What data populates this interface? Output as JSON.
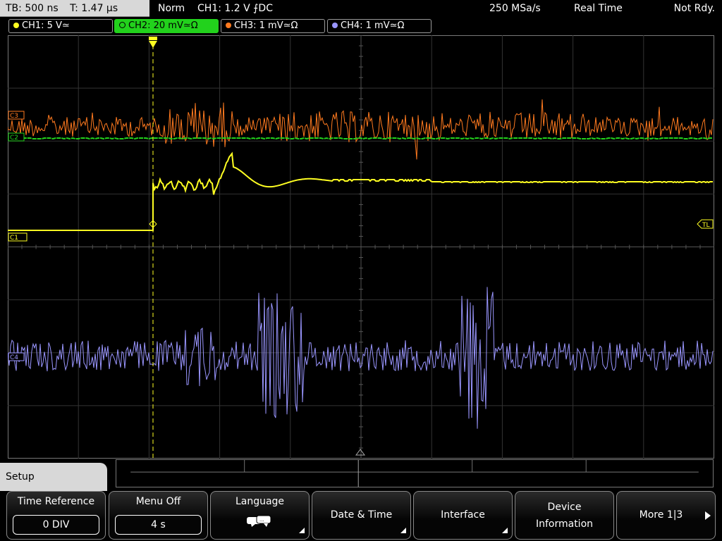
{
  "status": {
    "timebase": "TB: 500 ns",
    "trigger_time": "T: 1.47 µs",
    "mode": "Norm",
    "trigger_info": "CH1: 1.2 V ⨍DC",
    "sample_rate": "250 MSa/s",
    "acq_mode": "Real Time",
    "state": "Not Rdy."
  },
  "channels": [
    {
      "label": "CH1: 5 V≃",
      "color": "#ffff22"
    },
    {
      "label": "CH2: 20 mV≃Ω",
      "color": "#22d21c",
      "active": true
    },
    {
      "label": "CH3: 1 mV≃Ω",
      "color": "#ff7a1f"
    },
    {
      "label": "CH4: 1 mV≃Ω",
      "color": "#9a96ff"
    }
  ],
  "markers": {
    "c3": "C3",
    "c2": "C2",
    "c1": "C1",
    "c4": "C4",
    "tl": "TL"
  },
  "menu": {
    "title": "Setup",
    "softkeys": [
      {
        "label": "Time Reference",
        "value": "0 DIV"
      },
      {
        "label": "Menu Off",
        "value": "4 s"
      },
      {
        "label": "Language",
        "icon": "speech-bubbles-icon"
      },
      {
        "label": "Date & Time"
      },
      {
        "label": "Interface"
      },
      {
        "label1": "Device",
        "label2": "Information"
      },
      {
        "label": "More 1|3"
      }
    ]
  },
  "colors": {
    "grid": "#3a3a3a",
    "ch1": "#ffff22",
    "ch2": "#22d21c",
    "ch3": "#ff7a1f",
    "ch4": "#9a96ff"
  }
}
